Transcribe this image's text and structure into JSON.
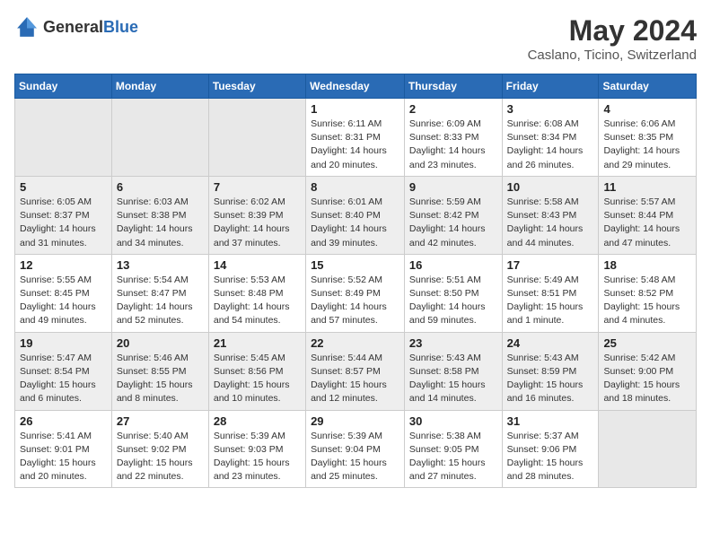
{
  "header": {
    "logo_general": "General",
    "logo_blue": "Blue",
    "title": "May 2024",
    "subtitle": "Caslano, Ticino, Switzerland"
  },
  "columns": [
    "Sunday",
    "Monday",
    "Tuesday",
    "Wednesday",
    "Thursday",
    "Friday",
    "Saturday"
  ],
  "weeks": [
    [
      {
        "day": "",
        "sunrise": "",
        "sunset": "",
        "daylight": "",
        "empty": true
      },
      {
        "day": "",
        "sunrise": "",
        "sunset": "",
        "daylight": "",
        "empty": true
      },
      {
        "day": "",
        "sunrise": "",
        "sunset": "",
        "daylight": "",
        "empty": true
      },
      {
        "day": "1",
        "sunrise": "Sunrise: 6:11 AM",
        "sunset": "Sunset: 8:31 PM",
        "daylight": "Daylight: 14 hours and 20 minutes."
      },
      {
        "day": "2",
        "sunrise": "Sunrise: 6:09 AM",
        "sunset": "Sunset: 8:33 PM",
        "daylight": "Daylight: 14 hours and 23 minutes."
      },
      {
        "day": "3",
        "sunrise": "Sunrise: 6:08 AM",
        "sunset": "Sunset: 8:34 PM",
        "daylight": "Daylight: 14 hours and 26 minutes."
      },
      {
        "day": "4",
        "sunrise": "Sunrise: 6:06 AM",
        "sunset": "Sunset: 8:35 PM",
        "daylight": "Daylight: 14 hours and 29 minutes."
      }
    ],
    [
      {
        "day": "5",
        "sunrise": "Sunrise: 6:05 AM",
        "sunset": "Sunset: 8:37 PM",
        "daylight": "Daylight: 14 hours and 31 minutes."
      },
      {
        "day": "6",
        "sunrise": "Sunrise: 6:03 AM",
        "sunset": "Sunset: 8:38 PM",
        "daylight": "Daylight: 14 hours and 34 minutes."
      },
      {
        "day": "7",
        "sunrise": "Sunrise: 6:02 AM",
        "sunset": "Sunset: 8:39 PM",
        "daylight": "Daylight: 14 hours and 37 minutes."
      },
      {
        "day": "8",
        "sunrise": "Sunrise: 6:01 AM",
        "sunset": "Sunset: 8:40 PM",
        "daylight": "Daylight: 14 hours and 39 minutes."
      },
      {
        "day": "9",
        "sunrise": "Sunrise: 5:59 AM",
        "sunset": "Sunset: 8:42 PM",
        "daylight": "Daylight: 14 hours and 42 minutes."
      },
      {
        "day": "10",
        "sunrise": "Sunrise: 5:58 AM",
        "sunset": "Sunset: 8:43 PM",
        "daylight": "Daylight: 14 hours and 44 minutes."
      },
      {
        "day": "11",
        "sunrise": "Sunrise: 5:57 AM",
        "sunset": "Sunset: 8:44 PM",
        "daylight": "Daylight: 14 hours and 47 minutes."
      }
    ],
    [
      {
        "day": "12",
        "sunrise": "Sunrise: 5:55 AM",
        "sunset": "Sunset: 8:45 PM",
        "daylight": "Daylight: 14 hours and 49 minutes."
      },
      {
        "day": "13",
        "sunrise": "Sunrise: 5:54 AM",
        "sunset": "Sunset: 8:47 PM",
        "daylight": "Daylight: 14 hours and 52 minutes."
      },
      {
        "day": "14",
        "sunrise": "Sunrise: 5:53 AM",
        "sunset": "Sunset: 8:48 PM",
        "daylight": "Daylight: 14 hours and 54 minutes."
      },
      {
        "day": "15",
        "sunrise": "Sunrise: 5:52 AM",
        "sunset": "Sunset: 8:49 PM",
        "daylight": "Daylight: 14 hours and 57 minutes."
      },
      {
        "day": "16",
        "sunrise": "Sunrise: 5:51 AM",
        "sunset": "Sunset: 8:50 PM",
        "daylight": "Daylight: 14 hours and 59 minutes."
      },
      {
        "day": "17",
        "sunrise": "Sunrise: 5:49 AM",
        "sunset": "Sunset: 8:51 PM",
        "daylight": "Daylight: 15 hours and 1 minute."
      },
      {
        "day": "18",
        "sunrise": "Sunrise: 5:48 AM",
        "sunset": "Sunset: 8:52 PM",
        "daylight": "Daylight: 15 hours and 4 minutes."
      }
    ],
    [
      {
        "day": "19",
        "sunrise": "Sunrise: 5:47 AM",
        "sunset": "Sunset: 8:54 PM",
        "daylight": "Daylight: 15 hours and 6 minutes."
      },
      {
        "day": "20",
        "sunrise": "Sunrise: 5:46 AM",
        "sunset": "Sunset: 8:55 PM",
        "daylight": "Daylight: 15 hours and 8 minutes."
      },
      {
        "day": "21",
        "sunrise": "Sunrise: 5:45 AM",
        "sunset": "Sunset: 8:56 PM",
        "daylight": "Daylight: 15 hours and 10 minutes."
      },
      {
        "day": "22",
        "sunrise": "Sunrise: 5:44 AM",
        "sunset": "Sunset: 8:57 PM",
        "daylight": "Daylight: 15 hours and 12 minutes."
      },
      {
        "day": "23",
        "sunrise": "Sunrise: 5:43 AM",
        "sunset": "Sunset: 8:58 PM",
        "daylight": "Daylight: 15 hours and 14 minutes."
      },
      {
        "day": "24",
        "sunrise": "Sunrise: 5:43 AM",
        "sunset": "Sunset: 8:59 PM",
        "daylight": "Daylight: 15 hours and 16 minutes."
      },
      {
        "day": "25",
        "sunrise": "Sunrise: 5:42 AM",
        "sunset": "Sunset: 9:00 PM",
        "daylight": "Daylight: 15 hours and 18 minutes."
      }
    ],
    [
      {
        "day": "26",
        "sunrise": "Sunrise: 5:41 AM",
        "sunset": "Sunset: 9:01 PM",
        "daylight": "Daylight: 15 hours and 20 minutes."
      },
      {
        "day": "27",
        "sunrise": "Sunrise: 5:40 AM",
        "sunset": "Sunset: 9:02 PM",
        "daylight": "Daylight: 15 hours and 22 minutes."
      },
      {
        "day": "28",
        "sunrise": "Sunrise: 5:39 AM",
        "sunset": "Sunset: 9:03 PM",
        "daylight": "Daylight: 15 hours and 23 minutes."
      },
      {
        "day": "29",
        "sunrise": "Sunrise: 5:39 AM",
        "sunset": "Sunset: 9:04 PM",
        "daylight": "Daylight: 15 hours and 25 minutes."
      },
      {
        "day": "30",
        "sunrise": "Sunrise: 5:38 AM",
        "sunset": "Sunset: 9:05 PM",
        "daylight": "Daylight: 15 hours and 27 minutes."
      },
      {
        "day": "31",
        "sunrise": "Sunrise: 5:37 AM",
        "sunset": "Sunset: 9:06 PM",
        "daylight": "Daylight: 15 hours and 28 minutes."
      },
      {
        "day": "",
        "sunrise": "",
        "sunset": "",
        "daylight": "",
        "empty": true
      }
    ]
  ]
}
